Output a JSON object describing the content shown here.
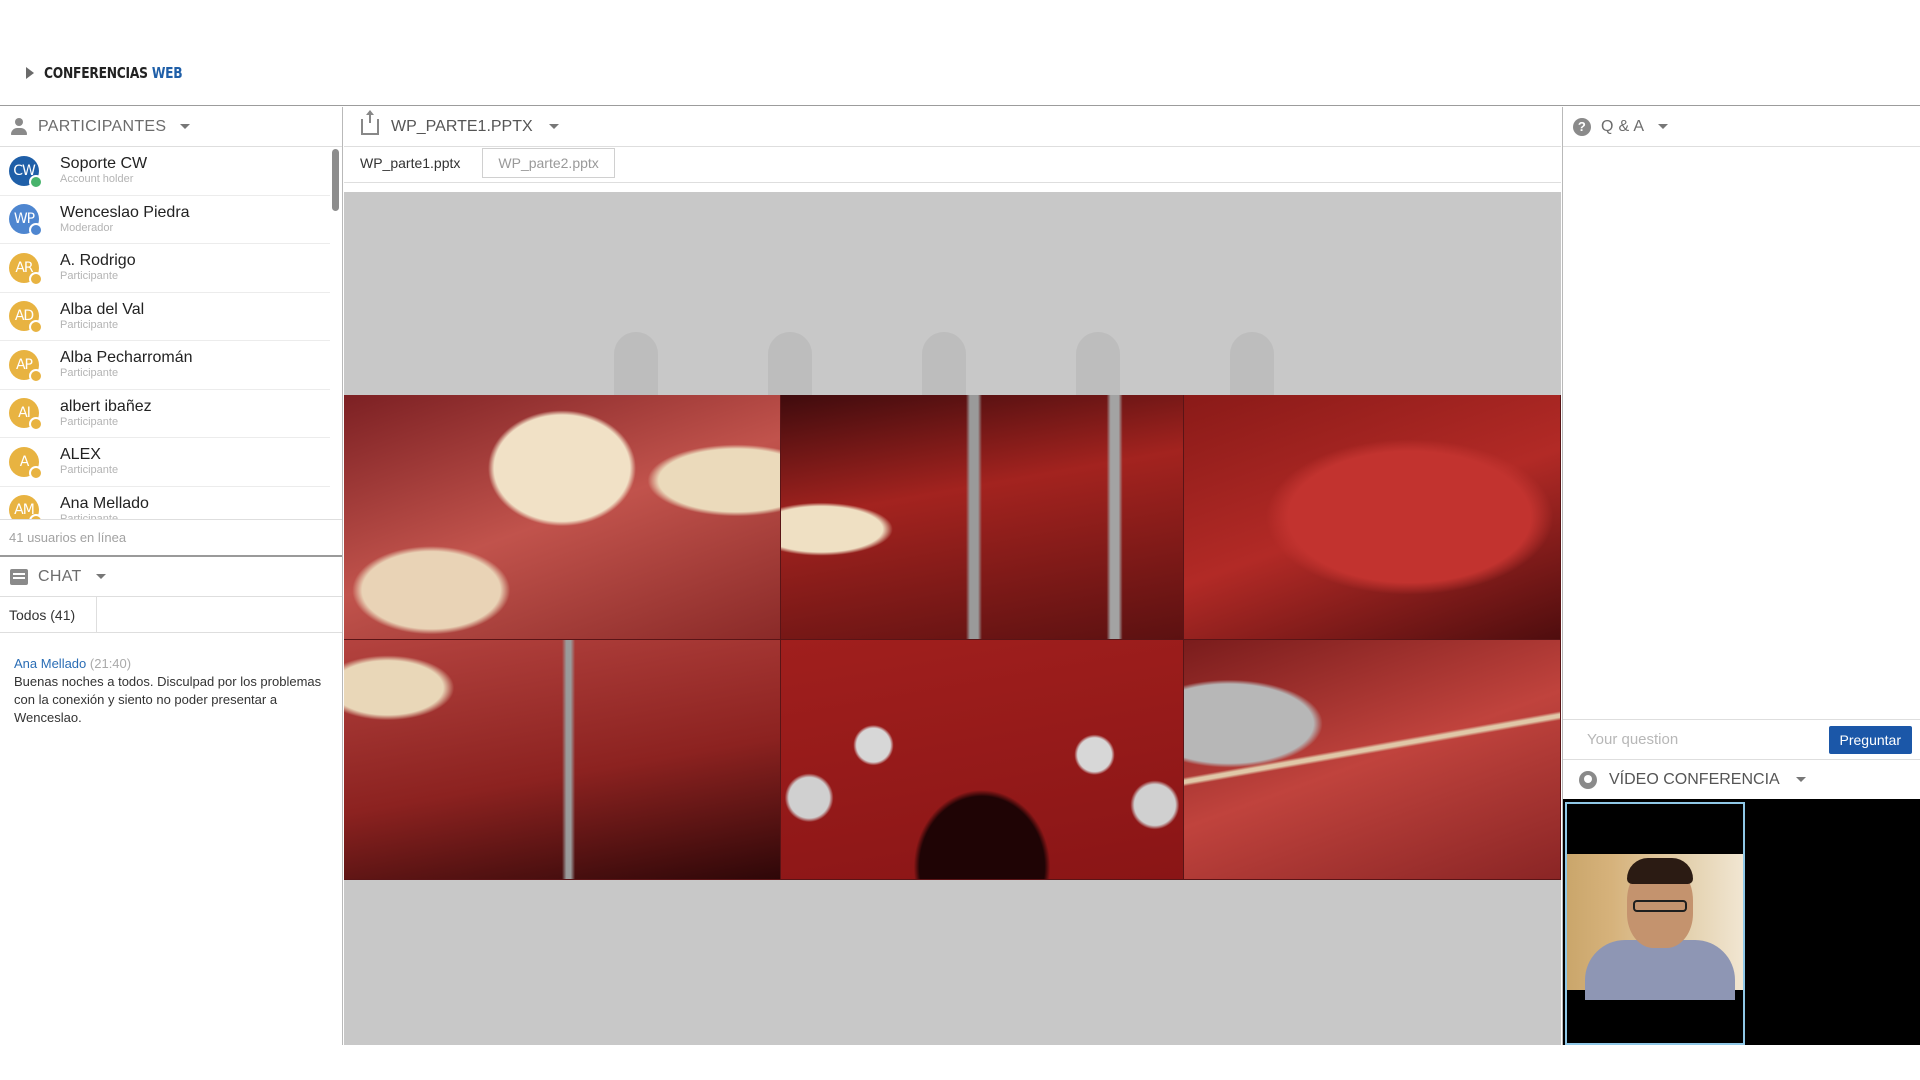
{
  "header": {
    "brand_primary": "CONFERENCIAS",
    "brand_accent": "WEB"
  },
  "participants": {
    "title": "PARTICIPANTES",
    "items": [
      {
        "initials": "CW",
        "name": "Soporte CW",
        "role": "Account holder",
        "color": "#1f5fa8",
        "badge_color": "#47b36b"
      },
      {
        "initials": "WP",
        "name": "Wenceslao Piedra",
        "role": "Moderador",
        "color": "#4e86d0",
        "badge_color": "#4e86d0"
      },
      {
        "initials": "AR",
        "name": "A. Rodrigo",
        "role": "Participante",
        "color": "#e8b341",
        "badge_color": "#e8b341"
      },
      {
        "initials": "AD",
        "name": "Alba del Val",
        "role": "Participante",
        "color": "#e8b341",
        "badge_color": "#e8b341"
      },
      {
        "initials": "AP",
        "name": "Alba Pecharromán",
        "role": "Participante",
        "color": "#e8b341",
        "badge_color": "#e8b341"
      },
      {
        "initials": "AI",
        "name": "albert ibañez",
        "role": "Participante",
        "color": "#e8b341",
        "badge_color": "#e8b341"
      },
      {
        "initials": "A",
        "name": "ALEX",
        "role": "Participante",
        "color": "#e8b341",
        "badge_color": "#e8b341"
      },
      {
        "initials": "AM",
        "name": "Ana Mellado",
        "role": "Participante",
        "color": "#e8b341",
        "badge_color": "#e8b341"
      }
    ],
    "online_count": "41 usuarios en línea"
  },
  "chat": {
    "title": "CHAT",
    "tab_all": "Todos (41)",
    "messages": [
      {
        "author": "Ana Mellado",
        "time": "(21:40)",
        "text": "Buenas noches a todos. Disculpad por los problemas con la conexión y siento no poder presentar a Wenceslao."
      }
    ]
  },
  "presentation": {
    "title": "WP_PARTE1.PPTX",
    "tabs": [
      "WP_parte1.pptx",
      "WP_parte2.pptx"
    ]
  },
  "qa": {
    "title": "Q & A",
    "placeholder": "Your question",
    "submit_label": "Preguntar"
  },
  "video": {
    "title": "VÍDEO CONFERENCIA"
  },
  "colors": {
    "accent": "#1f5fa8",
    "button": "#1b57a8",
    "stage_bg": "#c8c8c8",
    "video_border": "#8fc7e6"
  }
}
